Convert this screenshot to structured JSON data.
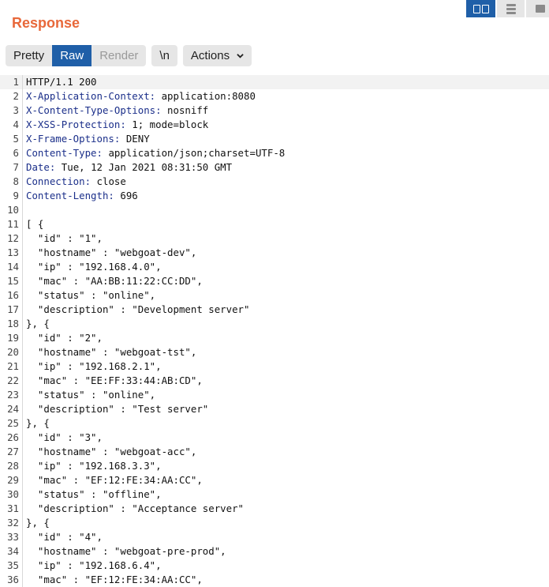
{
  "panel": {
    "title": "Response"
  },
  "layout_toggles": [
    {
      "name": "split-columns",
      "active": true
    },
    {
      "name": "split-rows",
      "active": false
    },
    {
      "name": "single-pane",
      "active": false
    }
  ],
  "toolbar": {
    "pretty": "Pretty",
    "raw": "Raw",
    "render": "Render",
    "newline": "\\n",
    "actions": "Actions"
  },
  "lines": [
    {
      "n": "1",
      "k": "",
      "v": "HTTP/1.1 200"
    },
    {
      "n": "2",
      "k": "X-Application-Context:",
      "v": " application:8080"
    },
    {
      "n": "3",
      "k": "X-Content-Type-Options:",
      "v": " nosniff"
    },
    {
      "n": "4",
      "k": "X-XSS-Protection:",
      "v": " 1; mode=block"
    },
    {
      "n": "5",
      "k": "X-Frame-Options:",
      "v": " DENY"
    },
    {
      "n": "6",
      "k": "Content-Type:",
      "v": " application/json;charset=UTF-8"
    },
    {
      "n": "7",
      "k": "Date:",
      "v": " Tue, 12 Jan 2021 08:31:50 GMT"
    },
    {
      "n": "8",
      "k": "Connection:",
      "v": " close"
    },
    {
      "n": "9",
      "k": "Content-Length:",
      "v": " 696"
    },
    {
      "n": "10",
      "k": "",
      "v": ""
    },
    {
      "n": "11",
      "k": "",
      "v": "[ {"
    },
    {
      "n": "12",
      "k": "",
      "v": "  \"id\" : \"1\","
    },
    {
      "n": "13",
      "k": "",
      "v": "  \"hostname\" : \"webgoat-dev\","
    },
    {
      "n": "14",
      "k": "",
      "v": "  \"ip\" : \"192.168.4.0\","
    },
    {
      "n": "15",
      "k": "",
      "v": "  \"mac\" : \"AA:BB:11:22:CC:DD\","
    },
    {
      "n": "16",
      "k": "",
      "v": "  \"status\" : \"online\","
    },
    {
      "n": "17",
      "k": "",
      "v": "  \"description\" : \"Development server\""
    },
    {
      "n": "18",
      "k": "",
      "v": "}, {"
    },
    {
      "n": "19",
      "k": "",
      "v": "  \"id\" : \"2\","
    },
    {
      "n": "20",
      "k": "",
      "v": "  \"hostname\" : \"webgoat-tst\","
    },
    {
      "n": "21",
      "k": "",
      "v": "  \"ip\" : \"192.168.2.1\","
    },
    {
      "n": "22",
      "k": "",
      "v": "  \"mac\" : \"EE:FF:33:44:AB:CD\","
    },
    {
      "n": "23",
      "k": "",
      "v": "  \"status\" : \"online\","
    },
    {
      "n": "24",
      "k": "",
      "v": "  \"description\" : \"Test server\""
    },
    {
      "n": "25",
      "k": "",
      "v": "}, {"
    },
    {
      "n": "26",
      "k": "",
      "v": "  \"id\" : \"3\","
    },
    {
      "n": "27",
      "k": "",
      "v": "  \"hostname\" : \"webgoat-acc\","
    },
    {
      "n": "28",
      "k": "",
      "v": "  \"ip\" : \"192.168.3.3\","
    },
    {
      "n": "29",
      "k": "",
      "v": "  \"mac\" : \"EF:12:FE:34:AA:CC\","
    },
    {
      "n": "30",
      "k": "",
      "v": "  \"status\" : \"offline\","
    },
    {
      "n": "31",
      "k": "",
      "v": "  \"description\" : \"Acceptance server\""
    },
    {
      "n": "32",
      "k": "",
      "v": "}, {"
    },
    {
      "n": "33",
      "k": "",
      "v": "  \"id\" : \"4\","
    },
    {
      "n": "34",
      "k": "",
      "v": "  \"hostname\" : \"webgoat-pre-prod\","
    },
    {
      "n": "35",
      "k": "",
      "v": "  \"ip\" : \"192.168.6.4\","
    },
    {
      "n": "36",
      "k": "",
      "v": "  \"mac\" : \"EF:12:FE:34:AA:CC\","
    }
  ],
  "highlighted_line": "1",
  "colors": {
    "title": "#e8683a",
    "active_button": "#1f5fa8",
    "header_key": "#1b2f8a"
  }
}
